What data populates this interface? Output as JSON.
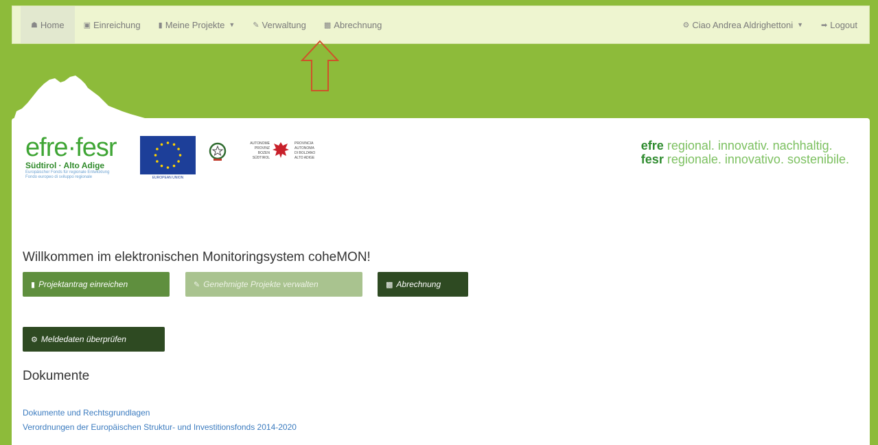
{
  "nav": {
    "home": "Home",
    "einreichung": "Einreichung",
    "meine_projekte": "Meine Projekte",
    "verwaltung": "Verwaltung",
    "abrechnung": "Abrechnung",
    "user": "Ciao Andrea Aldrighettoni",
    "logout": "Logout"
  },
  "logos": {
    "efre_word": "efre·fesr",
    "efre_sub": "Südtirol · Alto Adige",
    "efre_tiny_1": "Europäischer Fonds für regionale Entwicklung",
    "efre_tiny_2": "Fondo europeo di sviluppo regionale",
    "eu_caption": "EUROPEAN UNION",
    "prov_de_1": "AUTONOME",
    "prov_de_2": "PROVINZ",
    "prov_de_3": "BOZEN",
    "prov_de_4": "SÜDTIROL",
    "prov_it_1": "PROVINCIA",
    "prov_it_2": "AUTONOMA",
    "prov_it_3": "DI BOLZANO",
    "prov_it_4": "ALTO ADIGE"
  },
  "slogan": {
    "line1_brand": "efre",
    "line1_text": " regional. innovativ. nachhaltig.",
    "line2_brand": "fesr",
    "line2_text": " regionale. innovativo. sostenibile."
  },
  "main": {
    "welcome": "Willkommen im elektronischen Monitoringsystem coheMON!",
    "btn_antrag": "Projektantrag einreichen",
    "btn_genehmigt": "Genehmigte Projekte verwalten",
    "btn_abrechnung": "Abrechnung",
    "btn_melde": "Meldedaten überprüfen",
    "docs_title": "Dokumente",
    "doc_link_1": "Dokumente und Rechtsgrundlagen",
    "doc_link_2": "Verordnungen der Europäischen Struktur- und Investitionsfonds 2014-2020"
  },
  "colors": {
    "header_green": "#8dbb3a",
    "navbar_bg": "#eef5d0",
    "btn_dark": "#2e4a22",
    "btn_mid": "#5f8f3e",
    "btn_light": "#a9c38f",
    "link_blue": "#3b7bbf",
    "arrow_red": "#d0502a"
  },
  "icons": {
    "home": "home-icon",
    "einreichung": "camera-icon",
    "meine_projekte": "book-icon",
    "verwaltung": "pencil-icon",
    "abrechnung": "money-icon",
    "user": "gear-icon",
    "logout": "logout-icon"
  }
}
